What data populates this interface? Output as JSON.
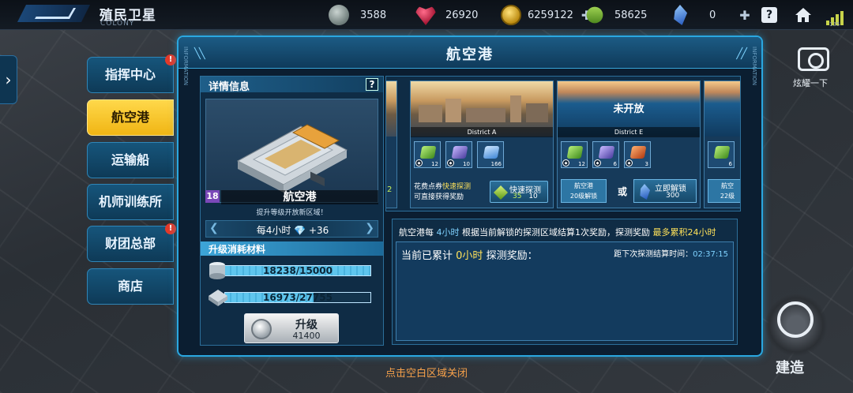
{
  "header": {
    "title": "殖民卫星",
    "subtitle": "COLONY",
    "resources": [
      {
        "icon": "ore-icon",
        "value": "3588"
      },
      {
        "icon": "heart-icon",
        "value": "26920"
      },
      {
        "icon": "coin-icon",
        "value": "6259122"
      },
      {
        "icon": "cube-icon",
        "value": "58625"
      },
      {
        "icon": "crystal-icon",
        "value": "0"
      }
    ],
    "help": "?",
    "signal_value": "135"
  },
  "menu": {
    "items": [
      {
        "label": "指挥中心",
        "badge": "!"
      },
      {
        "label": "航空港"
      },
      {
        "label": "运输船"
      },
      {
        "label": "机师训练所"
      },
      {
        "label": "财团总部",
        "badge": "!"
      },
      {
        "label": "商店"
      }
    ]
  },
  "panel": {
    "title": "航空港",
    "tag_left": "INFORMATION",
    "tag_right": "INFORMATION"
  },
  "detail": {
    "title": "详情信息",
    "help": "?",
    "level": "18",
    "building_name": "航空港",
    "note": "提升等级开放新区域！",
    "rate_text": "每4小时 💎 +36",
    "upgrade_title": "升级消耗材料",
    "materials": [
      {
        "icon": "metal-icon",
        "text": "18238/15000",
        "progress": 1.0
      },
      {
        "icon": "parts-icon",
        "text": "16973/27755",
        "progress": 0.61
      }
    ],
    "upgrade_label": "升级",
    "upgrade_cost": "41400"
  },
  "districts": [
    {
      "name": "District A",
      "rewards": [
        "12",
        "10",
        "166"
      ],
      "hint_prefix": "花费点券",
      "hint_highlight": "快速探测",
      "hint_suffix": "可直接获得奖励",
      "quick_label": "快速探测",
      "quick_cost": "35",
      "quick_cost2": "10"
    },
    {
      "name": "District E",
      "locked_text": "未开放",
      "rewards": [
        "12",
        "6",
        "3"
      ],
      "lock_note_1": "航空港",
      "lock_note_2": "20级解锁",
      "or_text": "或",
      "unlock_label": "立即解锁",
      "unlock_cost": "300"
    }
  ],
  "partial": {
    "left_digits": "2",
    "right_reward": "6",
    "right_note_1": "航空",
    "right_note_2": "22级"
  },
  "info": {
    "line_prefix": "航空港每",
    "line_interval": "4小时",
    "line_mid": "根据当前解锁的探测区域结算1次奖励，探测奖励",
    "line_max": "最多累积24小时",
    "acc_prefix": "当前已累计",
    "acc_hours": "0小时",
    "acc_suffix": "探测奖励：",
    "next_prefix": "距下次探测结算时间：",
    "next_time": "02:37:15"
  },
  "close_hint": "点击空白区域关闭",
  "right": {
    "camera_label": "炫耀一下",
    "build_label": "建造"
  },
  "colors": {
    "accent": "#2aa7e0",
    "active_tab": "#f0b514",
    "highlight": "#ffe25a"
  }
}
